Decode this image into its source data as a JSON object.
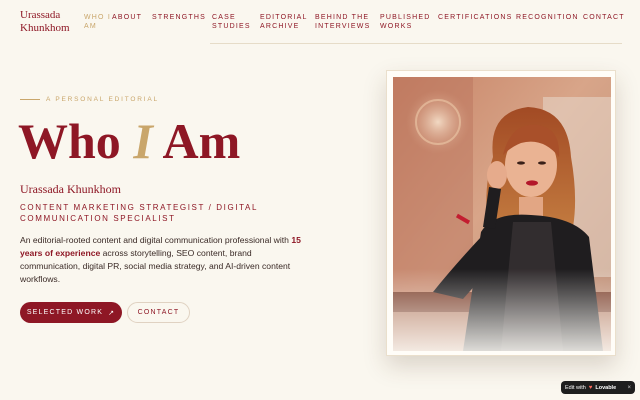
{
  "brand": {
    "name": "Urassada\nKhunkhom"
  },
  "nav": [
    {
      "label": "WHO I\nAM",
      "active": true
    },
    {
      "label": "ABOUT"
    },
    {
      "label": "STRENGTHS"
    },
    {
      "label": "CASE\nSTUDIES"
    },
    {
      "label": "EDITORIAL\nARCHIVE"
    },
    {
      "label": "BEHIND THE\nINTERVIEWS"
    },
    {
      "label": "PUBLISHED\nWORKS"
    },
    {
      "label": "CERTIFICATIONS"
    },
    {
      "label": "RECOGNITION"
    },
    {
      "label": "CONTACT"
    }
  ],
  "hero": {
    "eyebrow": "A PERSONAL EDITORIAL",
    "title_start": "Who ",
    "title_accent": "I",
    "title_end": " Am",
    "name": "Urassada Khunkhom",
    "role": "CONTENT MARKETING STRATEGIST / DIGITAL COMMUNICATION SPECIALIST",
    "bio_before": "An editorial-rooted content and digital communication professional with ",
    "bio_highlight": "15 years of experience",
    "bio_after": " across storytelling, SEO content, brand communication, digital PR, social media strategy, and AI-driven content workflows.",
    "primary_button": "SELECTED WORK",
    "primary_button_icon": "↗",
    "secondary_button": "CONTACT"
  },
  "photo": {
    "alt": "Portrait of Urassada Khunkhom"
  },
  "badge": {
    "label": "Edit with",
    "brand": "Lovable",
    "close": "×"
  },
  "colors": {
    "accent": "#8e1725",
    "gold": "#c9a66b",
    "background": "#faf7ef"
  }
}
